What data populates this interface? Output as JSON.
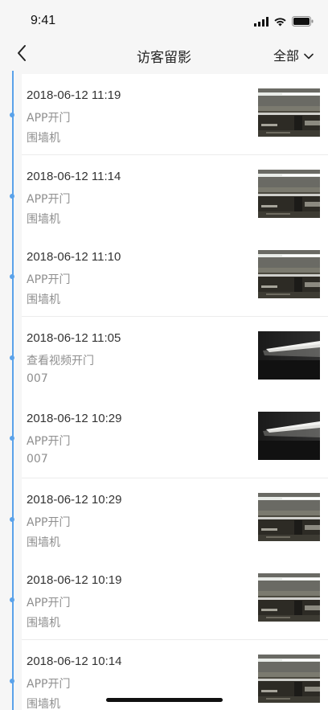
{
  "status_bar": {
    "time": "9:41"
  },
  "nav": {
    "title": "访客留影",
    "filter_label": "全部",
    "back_icon": "chevron-left-icon",
    "filter_icon": "chevron-down-icon"
  },
  "colors": {
    "accent": "#5aa2ea",
    "primary_text": "#333333",
    "secondary_text": "#8f8f8f",
    "background": "#f6f6f6",
    "card": "#ffffff"
  },
  "records": [
    {
      "time": "2018-06-12 11:19",
      "method": "APP开门",
      "device": "围墙机",
      "thumb": "garage"
    },
    {
      "time": "2018-06-12 11:14",
      "method": "APP开门",
      "device": "围墙机",
      "thumb": "garage"
    },
    {
      "time": "2018-06-12 11:10",
      "method": "APP开门",
      "device": "围墙机",
      "thumb": "garage"
    },
    {
      "time": "2018-06-12 11:05",
      "method": "查看视频开门",
      "device": "007",
      "thumb": "dark"
    },
    {
      "time": "2018-06-12 10:29",
      "method": "APP开门",
      "device": "007",
      "thumb": "dark"
    },
    {
      "time": "2018-06-12 10:29",
      "method": "APP开门",
      "device": "围墙机",
      "thumb": "garage"
    },
    {
      "time": "2018-06-12 10:19",
      "method": "APP开门",
      "device": "围墙机",
      "thumb": "garage"
    },
    {
      "time": "2018-06-12 10:14",
      "method": "APP开门",
      "device": "围墙机",
      "thumb": "garage"
    }
  ]
}
